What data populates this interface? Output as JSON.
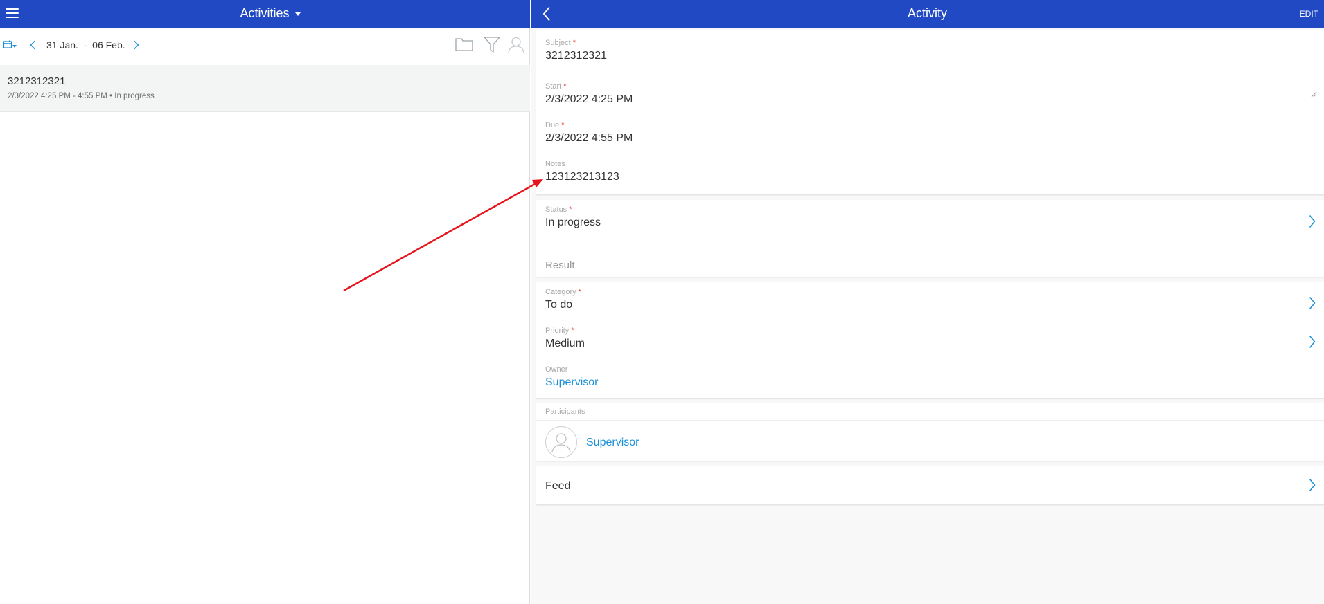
{
  "left": {
    "title": "Activities",
    "range_start": "31 Jan.",
    "range_sep": "-",
    "range_end": "06 Feb.",
    "activities": [
      {
        "title": "3212312321",
        "subtitle": "2/3/2022 4:25 PM - 4:55 PM • In progress"
      }
    ]
  },
  "right": {
    "title": "Activity",
    "edit_label": "EDIT",
    "fields": {
      "subject": {
        "label": "Subject",
        "value": "3212312321"
      },
      "start": {
        "label": "Start",
        "value": "2/3/2022 4:25 PM"
      },
      "due": {
        "label": "Due",
        "value": "2/3/2022 4:55 PM"
      },
      "notes": {
        "label": "Notes",
        "value": "123123213123"
      },
      "status": {
        "label": "Status",
        "value": "In progress"
      },
      "result": {
        "label": "Result"
      },
      "category": {
        "label": "Category",
        "value": "To do"
      },
      "priority": {
        "label": "Priority",
        "value": "Medium"
      },
      "owner": {
        "label": "Owner",
        "value": "Supervisor"
      }
    },
    "participants": {
      "label": "Participants",
      "items": [
        {
          "name": "Supervisor"
        }
      ]
    },
    "feed_label": "Feed",
    "required_mark": "*"
  },
  "icons": {
    "menu": "hamburger-icon",
    "calendar": "calendar-icon",
    "folder": "folder-icon",
    "filter": "filter-icon",
    "user": "user-icon",
    "back": "chevron-left-icon",
    "chevron": "chevron-right-icon",
    "avatar": "avatar-placeholder-icon"
  },
  "colors": {
    "header": "#2249c4",
    "accent": "#1a8fd6",
    "required": "#e53935",
    "annotation_arrow": "#e8141c"
  }
}
